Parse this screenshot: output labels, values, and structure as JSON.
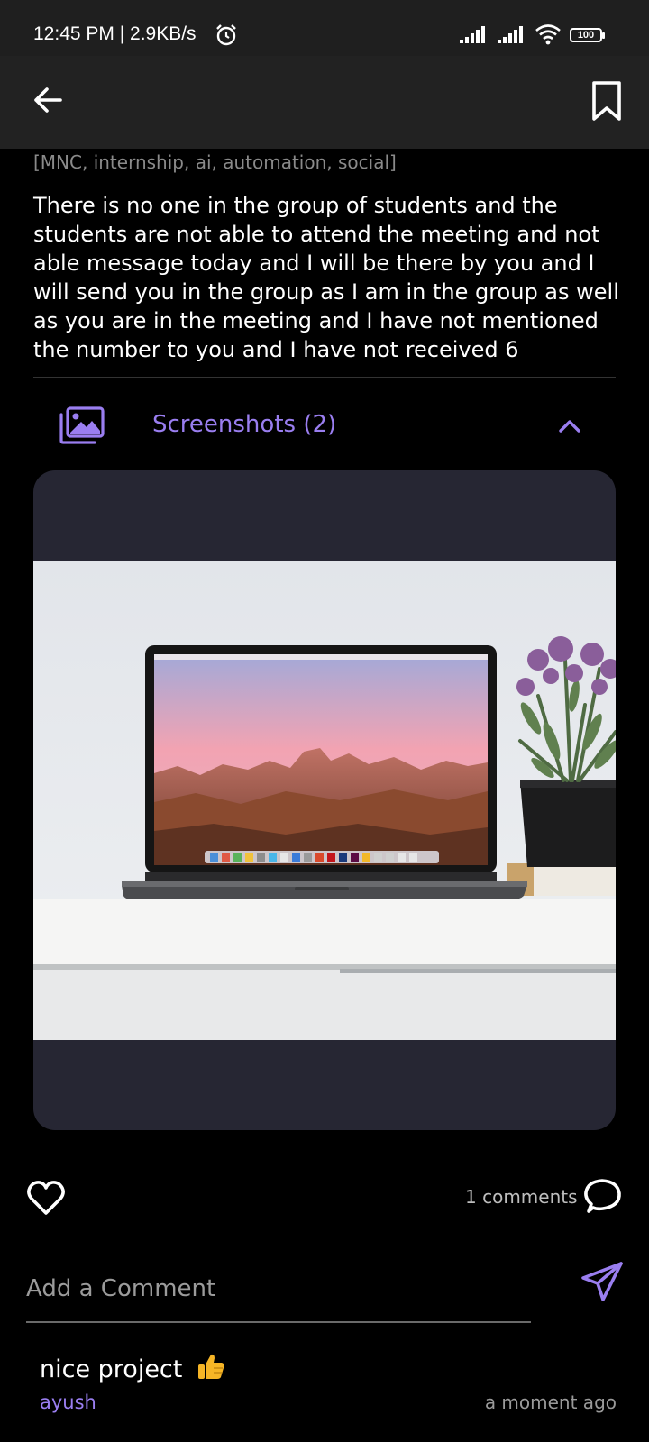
{
  "status_bar": {
    "time": "12:45 PM | 2.9KB/s",
    "battery": "100"
  },
  "post": {
    "tags": "[MNC, internship, ai, automation, social]",
    "description": "There is no one in the group of students and the students are not able to attend the meeting and not able message today and I will be there by you and I will send you in the group as I am in the group as well as you are in the meeting and I have not mentioned the number to you and I have not received 6",
    "screenshots_label": "Screenshots (2)"
  },
  "actions": {
    "comment_count": "1 comments"
  },
  "comment_input": {
    "placeholder": "Add a Comment"
  },
  "comments": [
    {
      "text": "nice project",
      "author": "ayush",
      "time": "a moment ago"
    }
  ],
  "colors": {
    "accent": "#9a7ef0",
    "background": "#000000",
    "appbar": "#222222",
    "card": "#262633"
  }
}
